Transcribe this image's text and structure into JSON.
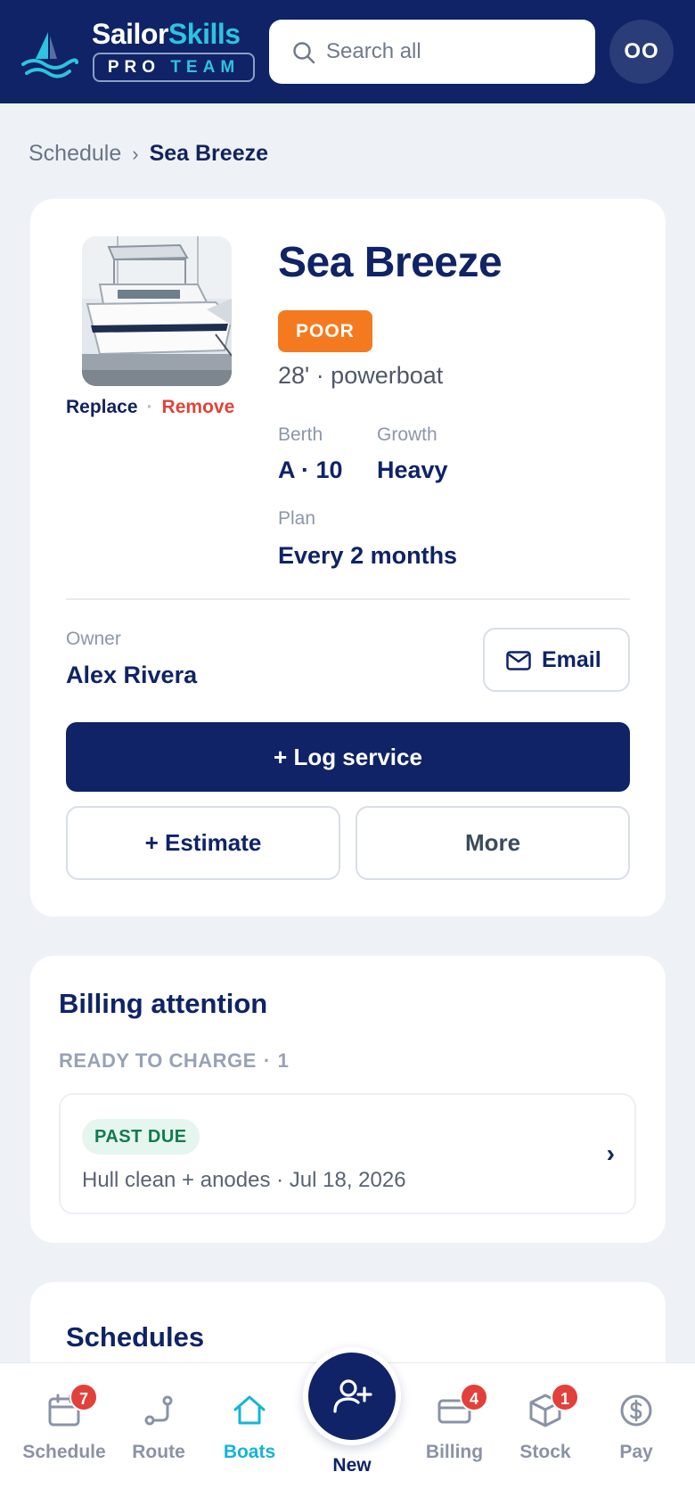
{
  "header": {
    "brand_primary": "Sailor",
    "brand_secondary": "Skills",
    "brand_tag_left": "PRO",
    "brand_tag_right": "TEAM",
    "search_placeholder": "Search all",
    "avatar_initials": "OO",
    "colors": {
      "background": "#0f2366",
      "accent": "#2ec3e0"
    }
  },
  "breadcrumb": {
    "parent": "Schedule",
    "separator": "›",
    "current": "Sea Breeze"
  },
  "boat": {
    "name": "Sea Breeze",
    "condition": "POOR",
    "condition_color": "#f57a1f",
    "meta": "28' · powerboat",
    "photo_actions": {
      "replace": "Replace",
      "separator": "·",
      "remove": "Remove"
    },
    "fields": {
      "berth_label": "Berth",
      "berth_value": "A · 10",
      "growth_label": "Growth",
      "growth_value": "Heavy",
      "plan_label": "Plan",
      "plan_value": "Every 2 months"
    },
    "owner_label": "Owner",
    "owner_name": "Alex Rivera",
    "email_label": "Email",
    "log_service_label": "+ Log service",
    "estimate_label": "+ Estimate",
    "more_label": "More"
  },
  "billing": {
    "title": "Billing attention",
    "subheading": "READY TO CHARGE",
    "separator": "·",
    "count": "1",
    "items": [
      {
        "status": "PAST DUE",
        "description": "Hull clean + anodes · Jul 18, 2026"
      }
    ]
  },
  "schedules": {
    "title": "Schedules"
  },
  "nav": {
    "items": [
      {
        "label": "Schedule",
        "icon": "calendar-icon",
        "badge": "7"
      },
      {
        "label": "Route",
        "icon": "route-icon"
      },
      {
        "label": "Boats",
        "icon": "home-icon",
        "active": true
      },
      {
        "label": "Billing",
        "icon": "credit-card-icon",
        "badge": "4"
      },
      {
        "label": "Stock",
        "icon": "box-icon",
        "badge": "1"
      },
      {
        "label": "Pay",
        "icon": "dollar-icon"
      }
    ],
    "new_label": "New",
    "new_icon": "add-user-icon",
    "active_color": "#14b5d4",
    "badge_color": "#e2403a"
  }
}
